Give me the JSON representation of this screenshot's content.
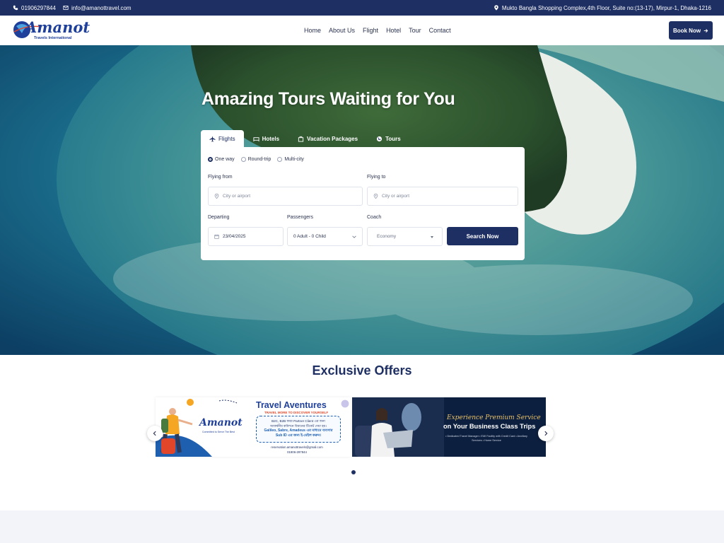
{
  "topbar": {
    "phone": "01906297844",
    "email": "info@amanottravel.com",
    "address": "Mukto Bangla Shopping Complex,4th Floor, Suite no:(13-17), Mirpur-1, Dhaka-1216"
  },
  "header": {
    "logo_text": "Amanot",
    "logo_subtext": "Travels International",
    "nav": [
      "Home",
      "About Us",
      "Flight",
      "Hotel",
      "Tour",
      "Contact"
    ],
    "book_label": "Book Now"
  },
  "hero": {
    "title": "Amazing Tours Waiting for You",
    "tabs": [
      "Flights",
      "Hotels",
      "Vacation Packages",
      "Tours"
    ],
    "active_tab": "Flights"
  },
  "search": {
    "trip_types": [
      "One way",
      "Round-trip",
      "Multi-city"
    ],
    "selected_trip": "One way",
    "from_label": "Flying from",
    "from_placeholder": "City or airport",
    "to_label": "Flying to",
    "to_placeholder": "City or airport",
    "depart_label": "Departing",
    "depart_value": "23/04/2025",
    "passengers_label": "Passengers",
    "passengers_value": "0 Adult - 0 Child",
    "coach_label": "Coach",
    "coach_value": "Economy",
    "search_label": "Search Now"
  },
  "offers": {
    "title": "Exclusive Offers",
    "card1": {
      "title": "Travel Aventures",
      "subtitle": "TRAVEL MORE TO DISCOVER YOURSELF",
      "line1": "B2C, B2B কবর Partner Client এর জন্য",
      "line2": "আকর্ষনীয় কমিশনে বিমানের টিকেট দেয়া হয়।",
      "line3": "Galileo, Sabre, Amadeus এর মাধ্যমে ব্যবসার",
      "line4": "Sub ID এর জন্য ই-মেইল করুন।",
      "email": "reservation.amanottravels@gmail.com",
      "phone": "01906-297844",
      "tagline": "Committed to Serve The Best"
    },
    "card2": {
      "script": "Experience Premium Service",
      "main": "on Your Business Class Trips",
      "bullets": "• Dedicated Travel Manager  • EMI Facility with Credit Card  • Ancillary Services  • Home Service"
    },
    "active_page": 1,
    "page_count": 1
  },
  "colors": {
    "brand_navy": "#1e2f63",
    "accent_orange": "#f5a623",
    "sea_teal": "#0f4d6c"
  }
}
